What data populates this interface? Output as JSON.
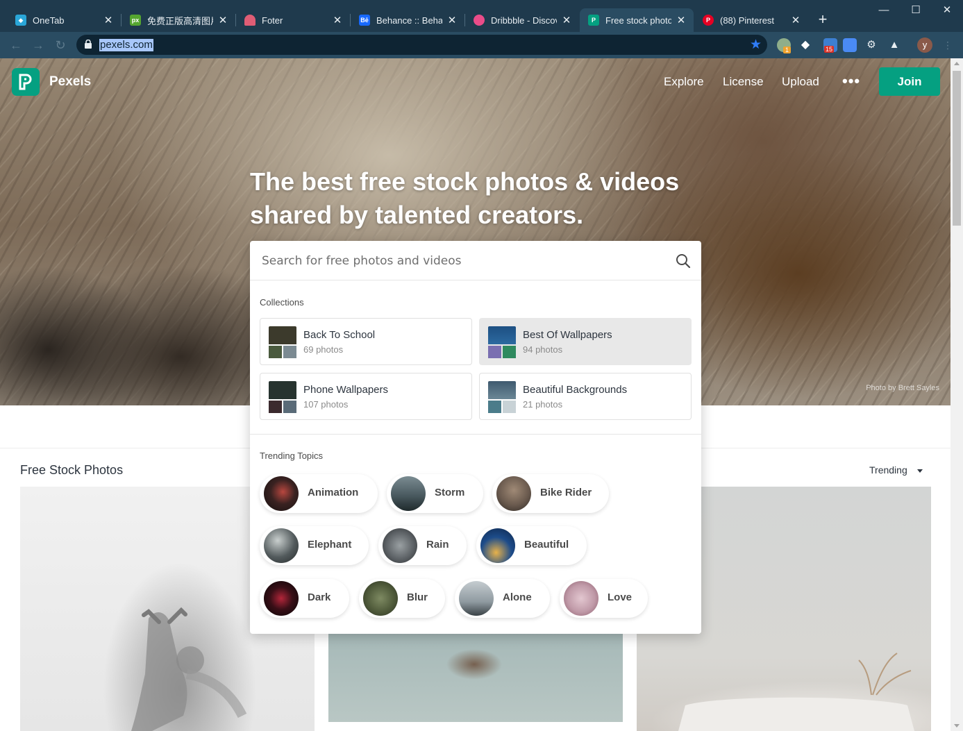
{
  "browser": {
    "tabs": [
      {
        "title": "OneTab",
        "icon": "onetab-icon",
        "color": "#2aa6d8"
      },
      {
        "title": "免费正版高清图片素",
        "icon": "px-icon",
        "color": "#55a630"
      },
      {
        "title": "Foter",
        "icon": "foter-icon",
        "color": "#e05d75"
      },
      {
        "title": "Behance :: Behance",
        "icon": "behance-icon",
        "color": "#1769ff"
      },
      {
        "title": "Dribbble - Discover",
        "icon": "dribbble-icon",
        "color": "#ea4c89"
      },
      {
        "title": "Free stock photos",
        "icon": "pexels-icon",
        "color": "#05a081"
      },
      {
        "title": "(88) Pinterest",
        "icon": "pinterest-icon",
        "color": "#e60023"
      }
    ],
    "active_tab": 5,
    "url": "pexels.com",
    "badges": {
      "ext1": "1",
      "ext3": "15"
    },
    "avatar_letter": "y"
  },
  "site": {
    "brand": "Pexels",
    "nav": [
      "Explore",
      "License",
      "Upload"
    ],
    "more": "•••",
    "join": "Join",
    "headline": "The best free stock photos & videos shared by talented creators.",
    "credit": "Photo by Brett Sayles",
    "accent": "#05a081"
  },
  "search": {
    "placeholder": "Search for free photos and videos",
    "collections_label": "Collections",
    "collections": [
      {
        "name": "Back To School",
        "count": "69 photos",
        "colors": [
          "#3c3a2c",
          "#4a5a3e",
          "#7b8a92"
        ]
      },
      {
        "name": "Best Of Wallpapers",
        "count": "94 photos",
        "colors": [
          "#1d4f82",
          "#7a6fb1",
          "#2f8a5f"
        ]
      },
      {
        "name": "Phone Wallpapers",
        "count": "107 photos",
        "colors": [
          "#27332f",
          "#3b2a2e",
          "#5a6b78"
        ]
      },
      {
        "name": "Beautiful Backgrounds",
        "count": "21 photos",
        "colors": [
          "#3f5a6f",
          "#4b7c8a",
          "#c8d2d6"
        ]
      }
    ],
    "trending_label": "Trending Topics",
    "topics": [
      {
        "label": "Animation",
        "color": "#3a2221"
      },
      {
        "label": "Storm",
        "color": "#4a5a60"
      },
      {
        "label": "Bike Rider",
        "color": "#6a5a4e"
      },
      {
        "label": "Elephant",
        "color": "#525a5c"
      },
      {
        "label": "Rain",
        "color": "#5d6266"
      },
      {
        "label": "Beautiful",
        "color": "#1d4c8a"
      },
      {
        "label": "Dark",
        "color": "#3a0f17"
      },
      {
        "label": "Blur",
        "color": "#4f5a3a"
      },
      {
        "label": "Alone",
        "color": "#8f9aa0"
      },
      {
        "label": "Love",
        "color": "#c09aa8"
      }
    ]
  },
  "content": {
    "section_title": "Free Stock Photos",
    "sort": "Trending"
  }
}
